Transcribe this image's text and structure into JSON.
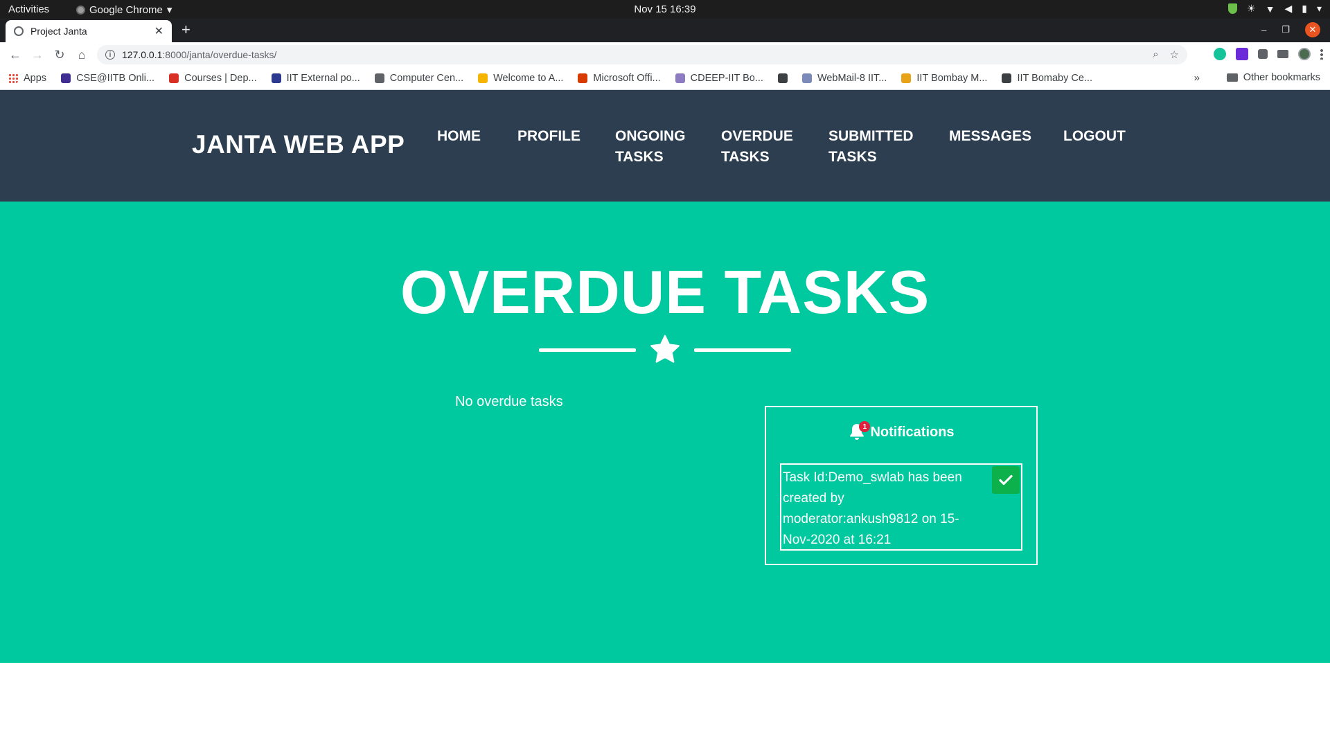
{
  "os_bar": {
    "activities": "Activities",
    "app_name": "Google Chrome",
    "clock": "Nov 15  16:39"
  },
  "browser": {
    "tab_title": "Project Janta",
    "url_host": "127.0.0.1",
    "url_path": ":8000/janta/overdue-tasks/",
    "bookmarks": [
      {
        "label": "Apps",
        "color": "#4285f4"
      },
      {
        "label": "CSE@IITB Onli...",
        "color": "#3f2d91"
      },
      {
        "label": "Courses | Dep...",
        "color": "#d93025"
      },
      {
        "label": "IIT External po...",
        "color": "#2b3a8f"
      },
      {
        "label": "Computer Cen...",
        "color": "#5f6368"
      },
      {
        "label": "Welcome to A...",
        "color": "#f4b400"
      },
      {
        "label": "Microsoft Offi...",
        "color": "#d83b01"
      },
      {
        "label": "CDEEP-IIT Bo...",
        "color": "#8e7cc3"
      },
      {
        "label": "",
        "color": "#3c4043"
      },
      {
        "label": "WebMail-8 IIT...",
        "color": "#7b8ab8"
      },
      {
        "label": "IIT Bombay M...",
        "color": "#e8a317"
      },
      {
        "label": "IIT Bomaby Ce...",
        "color": "#3c4043"
      }
    ],
    "bookmarks_more": "»",
    "other_bookmarks": "Other bookmarks"
  },
  "navbar": {
    "brand": "JANTA WEB APP",
    "items": [
      {
        "line1": "HOME",
        "line2": ""
      },
      {
        "line1": "PROFILE",
        "line2": ""
      },
      {
        "line1": "ONGOING",
        "line2": "TASKS"
      },
      {
        "line1": "OVERDUE",
        "line2": "TASKS"
      },
      {
        "line1": "SUBMITTED",
        "line2": "TASKS"
      },
      {
        "line1": "MESSAGES",
        "line2": ""
      },
      {
        "line1": "LOGOUT",
        "line2": ""
      }
    ]
  },
  "main": {
    "heading": "OVERDUE TASKS",
    "empty_message": "No overdue tasks"
  },
  "notifications": {
    "title": "Notifications",
    "badge_count": "1",
    "items": [
      {
        "text": "Task Id:Demo_swlab has been created by moderator:ankush9812 on 15-Nov-2020 at 16:21"
      }
    ]
  },
  "colors": {
    "navbar": "#2c3e50",
    "masthead": "#00c89f",
    "check_button": "#0db14b",
    "badge": "#e01f3d"
  }
}
